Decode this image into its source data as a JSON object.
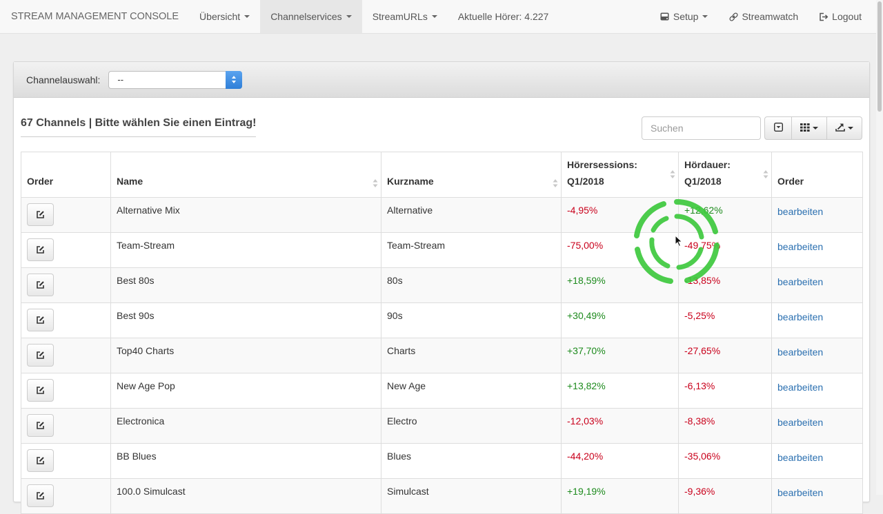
{
  "navbar": {
    "brand": "STREAM MANAGEMENT CONSOLE",
    "items": [
      {
        "label": "Übersicht",
        "dropdown": true
      },
      {
        "label": "Channelservices",
        "dropdown": true,
        "active": true
      },
      {
        "label": "StreamURLs",
        "dropdown": true
      },
      {
        "label": "Aktuelle Hörer: 4.227",
        "dropdown": false
      }
    ],
    "right": [
      {
        "label": "Setup",
        "icon": "hdd-icon",
        "dropdown": true
      },
      {
        "label": "Streamwatch",
        "icon": "link-icon",
        "dropdown": false
      },
      {
        "label": "Logout",
        "icon": "logout-icon",
        "dropdown": false
      }
    ]
  },
  "panel": {
    "channel_label": "Channelauswahl:",
    "channel_value": "--"
  },
  "toolbar": {
    "heading": "67 Channels | Bitte wählen Sie einen Eintrag!",
    "search_placeholder": "Suchen"
  },
  "table": {
    "columns": [
      {
        "line1": "",
        "line2": "Order"
      },
      {
        "line1": "",
        "line2": "Name"
      },
      {
        "line1": "",
        "line2": "Kurzname"
      },
      {
        "line1": "Hörersessions:",
        "line2": "Q1/2018"
      },
      {
        "line1": "Hördauer:",
        "line2": "Q1/2018"
      },
      {
        "line1": "",
        "line2": "Order"
      }
    ],
    "action_label": "bearbeiten",
    "rows": [
      {
        "name": "Alternative Mix",
        "short": "Alternative",
        "sessions": "-4,95%",
        "duration": "+12,62%"
      },
      {
        "name": "Team-Stream",
        "short": "Team-Stream",
        "sessions": "-75,00%",
        "duration": "-49,75%"
      },
      {
        "name": "Best 80s",
        "short": "80s",
        "sessions": "+18,59%",
        "duration": "-13,85%"
      },
      {
        "name": "Best 90s",
        "short": "90s",
        "sessions": "+30,49%",
        "duration": "-5,25%"
      },
      {
        "name": "Top40 Charts",
        "short": "Charts",
        "sessions": "+37,70%",
        "duration": "-27,65%"
      },
      {
        "name": "New Age Pop",
        "short": "New Age",
        "sessions": "+13,82%",
        "duration": "-6,13%"
      },
      {
        "name": "Electronica",
        "short": "Electro",
        "sessions": "-12,03%",
        "duration": "-8,38%"
      },
      {
        "name": "BB Blues",
        "short": "Blues",
        "sessions": "-44,20%",
        "duration": "-35,06%"
      },
      {
        "name": "100.0 Simulcast",
        "short": "Simulcast",
        "sessions": "+19,19%",
        "duration": "-9,36%"
      }
    ]
  },
  "colors": {
    "positive": "#1c8a1c",
    "negative": "#c9001b",
    "link": "#2a6fb0",
    "spinner": "#3ec93e"
  }
}
